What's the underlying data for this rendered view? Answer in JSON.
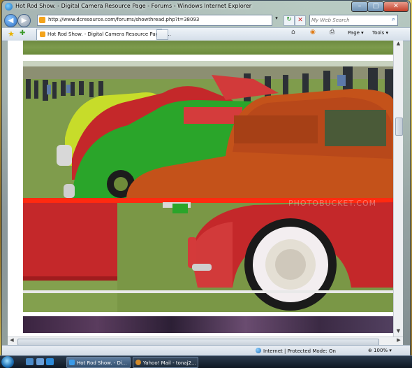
{
  "window": {
    "title": "Hot Rod Show. - Digital Camera Resource Page - Forums - Windows Internet Explorer",
    "min": "–",
    "max": "□",
    "close": "✕"
  },
  "address": {
    "back": "◀",
    "forward": "▶",
    "url": "http://www.dcresource.com/forums/showthread.php?t=38093",
    "dropdown": "▾",
    "refresh": "↻",
    "stop": "✕"
  },
  "search": {
    "placeholder": "My Web Search",
    "icon": "⌕"
  },
  "commandbar": {
    "favorites_icon": "★",
    "add_favorites_icon": "✚",
    "tab_label": "Hot Rod Show. - Digital Camera Resource Page - ...",
    "home_icon": "⌂",
    "feeds_icon": "◉",
    "print_icon": "⎙",
    "page_label": "Page ▾",
    "tools_label": "Tools ▾"
  },
  "content": {
    "watermark": "PHOTOBUCKET.COM",
    "scroll_up": "▲",
    "scroll_down": "▼",
    "scroll_left": "◀",
    "scroll_right": "▶"
  },
  "status": {
    "zone": "Internet | Protected Mode: On",
    "zoom": "100%",
    "zoom_arrow": "▾"
  },
  "taskbar": {
    "tasks": [
      {
        "label": "Hot Rod Show. - Di..."
      },
      {
        "label": "Yahoo! Mail - tonaj2..."
      }
    ]
  },
  "colors": {
    "car_orange": "#c4521a",
    "car_green": "#2aa52a",
    "car_red": "#c4282a",
    "car_yellow": "#c7dc2a"
  }
}
